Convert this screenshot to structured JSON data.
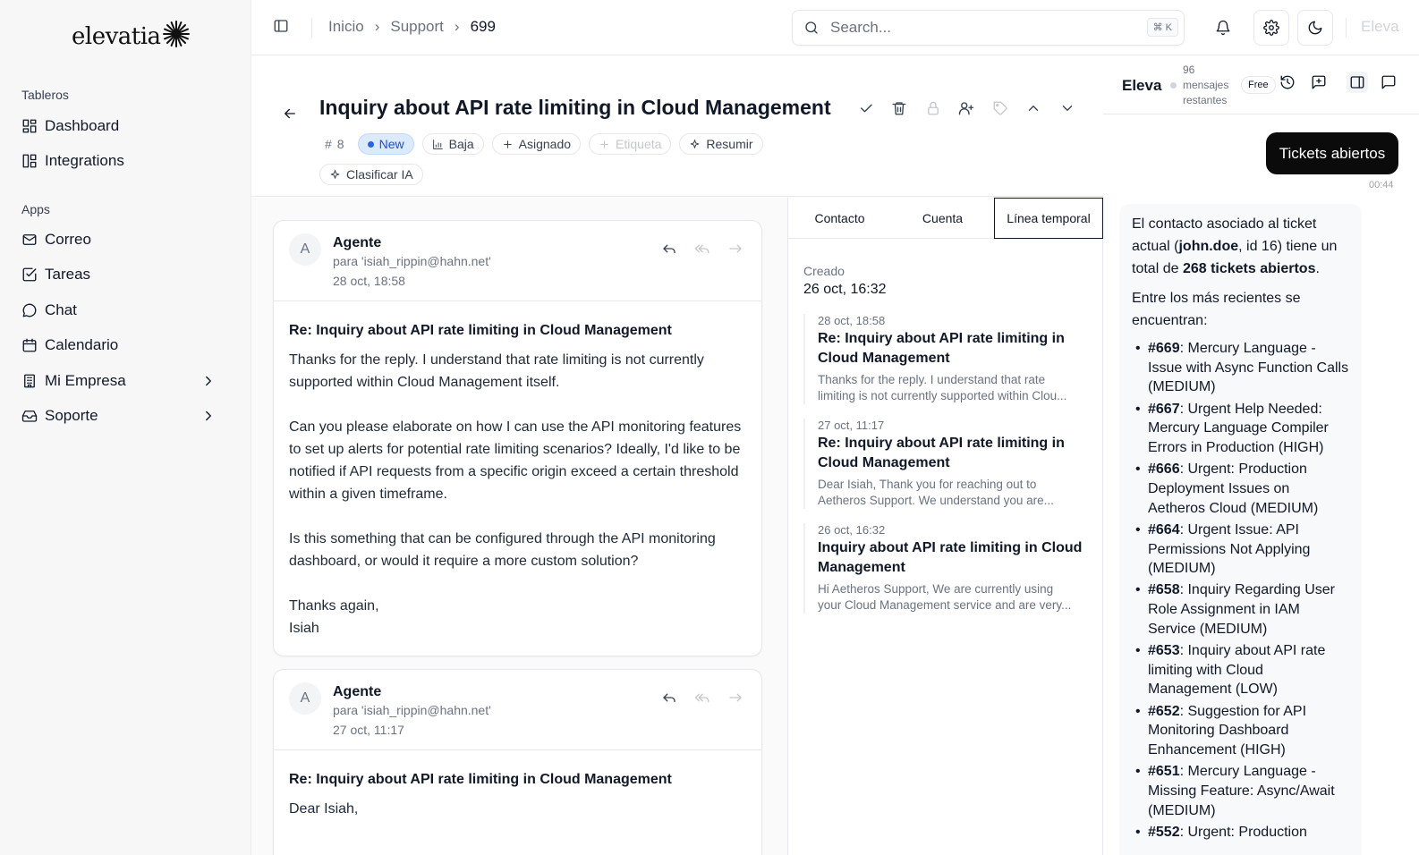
{
  "sidebar": {
    "brand": "elevatia",
    "sections": [
      {
        "label": "Tableros",
        "items": [
          {
            "label": "Dashboard"
          },
          {
            "label": "Integrations"
          }
        ]
      },
      {
        "label": "Apps",
        "items": [
          {
            "label": "Correo"
          },
          {
            "label": "Tareas"
          },
          {
            "label": "Chat"
          },
          {
            "label": "Calendario"
          },
          {
            "label": "Mi Empresa"
          },
          {
            "label": "Soporte"
          }
        ]
      }
    ]
  },
  "topbar": {
    "breadcrumb": [
      "Inicio",
      "Support",
      "699"
    ],
    "search": {
      "placeholder": "Search...",
      "shortcut": "⌘ K"
    },
    "user_name": "Eleva"
  },
  "ticket": {
    "title": "Inquiry about API rate limiting in Cloud Management",
    "number": "8",
    "status": "New",
    "priority": "Baja",
    "assign_label": "Asignado",
    "tag_label": "Etiqueta",
    "summarize_label": "Resumir",
    "classify_label": "Clasificar IA"
  },
  "messages": [
    {
      "avatar": "A",
      "author": "Agente",
      "to": "para 'isiah_rippin@hahn.net'",
      "date": "28 oct, 18:58",
      "subject": "Re: Inquiry about API rate limiting in Cloud Management",
      "paragraphs": [
        "Thanks for the reply. I understand that rate limiting is not currently supported within Cloud Management itself.",
        "Can you please elaborate on how I can use the API monitoring features to set up alerts for potential rate limiting scenarios? Ideally, I'd like to be notified if API requests from a specific origin exceed a certain threshold within a given timeframe.",
        "Is this something that can be configured through the API monitoring dashboard, or would it require a more custom solution?"
      ],
      "signoff": "Thanks again,",
      "signature": "Isiah"
    },
    {
      "avatar": "A",
      "author": "Agente",
      "to": "para 'isiah_rippin@hahn.net'",
      "date": "27 oct, 11:17",
      "subject": "Re: Inquiry about API rate limiting in Cloud Management",
      "paragraphs": [
        "Dear Isiah,"
      ]
    }
  ],
  "side_panel": {
    "tabs": [
      "Contacto",
      "Cuenta",
      "Línea temporal"
    ],
    "active_tab": "Línea temporal",
    "created_label": "Creado",
    "created_value": "26 oct, 16:32",
    "timeline": [
      {
        "date": "28 oct, 18:58",
        "title": "Re: Inquiry about API rate limiting in Cloud Management",
        "excerpt_1": "Thanks for the reply. I understand that rate",
        "excerpt_2": "limiting is not currently supported within Clou..."
      },
      {
        "date": "27 oct, 11:17",
        "title": "Re: Inquiry about API rate limiting in Cloud Management",
        "excerpt_1": "Dear Isiah, Thank you for reaching out to",
        "excerpt_2": "Aetheros Support. We understand you are..."
      },
      {
        "date": "26 oct, 16:32",
        "title": "Inquiry about API rate limiting in Cloud Management",
        "excerpt_1": "Hi Aetheros Support, We are currently using",
        "excerpt_2": "your Cloud Management service and are very..."
      }
    ]
  },
  "chat": {
    "title": "Eleva",
    "remaining_1": "96",
    "remaining_2": "mensajes",
    "remaining_3": "restantes",
    "plan": "Free",
    "user_message": "Tickets abiertos",
    "user_time": "00:44",
    "bot": {
      "intro_1": "El contacto asociado al ticket actual (",
      "contact": "john.doe",
      "intro_2": ", id 16) tiene un total de ",
      "total": "268 tickets abiertos",
      "intro_3": ".",
      "lead": "Entre los más recientes se encuentran:",
      "tickets": [
        {
          "id": "#669",
          "text": ": Mercury Language - Issue with Async Function Calls (MEDIUM)"
        },
        {
          "id": "#667",
          "text": ": Urgent Help Needed: Mercury Language Compiler Errors in Production (HIGH)"
        },
        {
          "id": "#666",
          "text": ": Urgent: Production Deployment Issues on Aetheros Cloud (MEDIUM)"
        },
        {
          "id": "#664",
          "text": ": Urgent Issue: API Permissions Not Applying (MEDIUM)"
        },
        {
          "id": "#658",
          "text": ": Inquiry Regarding User Role Assignment in IAM Service (MEDIUM)"
        },
        {
          "id": "#653",
          "text": ": Inquiry about API rate limiting with Cloud Management (LOW)"
        },
        {
          "id": "#652",
          "text": ": Suggestion for API Monitoring Dashboard Enhancement (HIGH)"
        },
        {
          "id": "#651",
          "text": ": Mercury Language - Missing Feature: Async/Await (MEDIUM)"
        },
        {
          "id": "#552",
          "text": ": Urgent: Production"
        }
      ]
    }
  },
  "colors": {
    "accent": "#111827",
    "status_new_bg": "#dbeafe",
    "status_new_fg": "#1d4ed8",
    "sidebar_bg": "#f7f7f8"
  }
}
